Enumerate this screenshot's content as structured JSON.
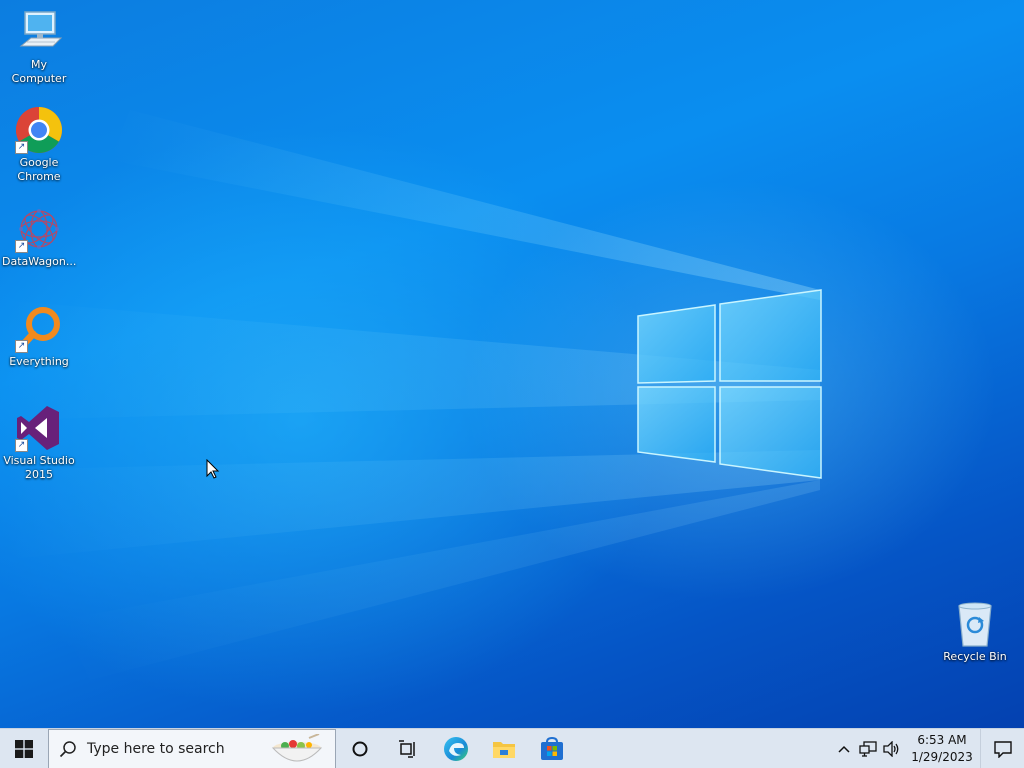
{
  "desktop": {
    "icons": [
      {
        "label": "My Computer",
        "icon": "computer-icon"
      },
      {
        "label": "Google Chrome",
        "icon": "chrome-icon"
      },
      {
        "label": "DataWagon...",
        "icon": "datawagon-icon"
      },
      {
        "label": "Everything",
        "icon": "everything-search-icon"
      },
      {
        "label": "Visual Studio 2015",
        "icon": "visual-studio-icon"
      },
      {
        "label": "Recycle Bin",
        "icon": "recycle-bin-icon"
      }
    ]
  },
  "taskbar": {
    "start_icon": "windows-logo-icon",
    "search_placeholder": "Type here to search",
    "search_art_icon": "salad-bowl-icon",
    "pinned": [
      {
        "name": "cortana",
        "icon": "cortana-circle-icon"
      },
      {
        "name": "task-view",
        "icon": "task-view-icon"
      },
      {
        "name": "edge",
        "icon": "edge-icon"
      },
      {
        "name": "file-explorer",
        "icon": "folder-icon"
      },
      {
        "name": "store",
        "icon": "store-icon"
      }
    ],
    "tray": {
      "icons": [
        "chevron-up-icon",
        "network-icon",
        "volume-icon"
      ],
      "time": "6:53 AM",
      "date": "1/29/2023",
      "notification_icon": "notification-icon"
    }
  },
  "colors": {
    "wallpaper_blue": "#0a8ef0",
    "taskbar": "#dde6f1"
  }
}
